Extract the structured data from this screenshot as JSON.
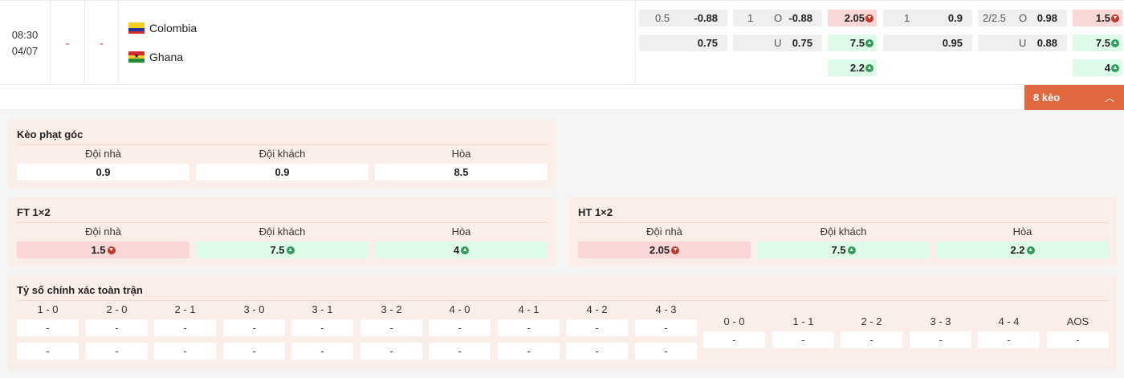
{
  "match": {
    "time": "08:30",
    "date": "04/07",
    "ht_score": "-",
    "ft_score": "-",
    "home_team": "Colombia",
    "away_team": "Ghana",
    "flags": [
      "colombia-flag-icon",
      "ghana-flag-icon"
    ]
  },
  "odds": {
    "ft_handicap": {
      "line": "0.5",
      "home": "-0.88",
      "away": "0.75"
    },
    "ft_over_under": {
      "line": "1",
      "over_label": "O",
      "over": "-0.88",
      "under_label": "U",
      "under": "0.75"
    },
    "ft_1x2": {
      "home": "2.05",
      "away": "7.5",
      "draw": "2.2"
    },
    "ht_handicap": {
      "line": "1",
      "home": "0.9",
      "away": "0.95"
    },
    "ht_over_under": {
      "line": "2/2.5",
      "over_label": "O",
      "over": "0.98",
      "under_label": "U",
      "under": "0.88"
    },
    "ht_1x2": {
      "home": "1.5",
      "away": "7.5",
      "draw": "4"
    }
  },
  "expand": {
    "label": "8 kèo",
    "icon": "chevron-up-icon"
  },
  "corner_panel": {
    "title": "Kèo phạt góc",
    "headers": [
      "Đội nhà",
      "Đội khách",
      "Hòa"
    ],
    "values": [
      "0.9",
      "0.9",
      "8.5"
    ]
  },
  "ft_panel": {
    "title": "FT 1×2",
    "headers": [
      "Đội nhà",
      "Đội khách",
      "Hòa"
    ],
    "values": [
      "1.5",
      "7.5",
      "4"
    ]
  },
  "ht_panel": {
    "title": "HT 1×2",
    "headers": [
      "Đội nhà",
      "Đội khách",
      "Hòa"
    ],
    "values": [
      "2.05",
      "7.5",
      "2.2"
    ]
  },
  "correct_score": {
    "title": "Tỷ số chính xác toàn trận",
    "home_scores": [
      "1 - 0",
      "2 - 0",
      "2 - 1",
      "3 - 0",
      "3 - 1",
      "3 - 2",
      "4 - 0",
      "4 - 1",
      "4 - 2",
      "4 - 3"
    ],
    "draw_scores": [
      "0 - 0",
      "1 - 1",
      "2 - 2",
      "3 - 3",
      "4 - 4",
      "AOS"
    ],
    "empty_value": "-"
  },
  "colors": {
    "accent": "#e0683f",
    "panel_bg": "#fbeee8",
    "down_red": "#c0392b",
    "up_green": "#2e9e5a",
    "red_bg": "#f8d7d6",
    "green_bg": "#defbe9"
  }
}
